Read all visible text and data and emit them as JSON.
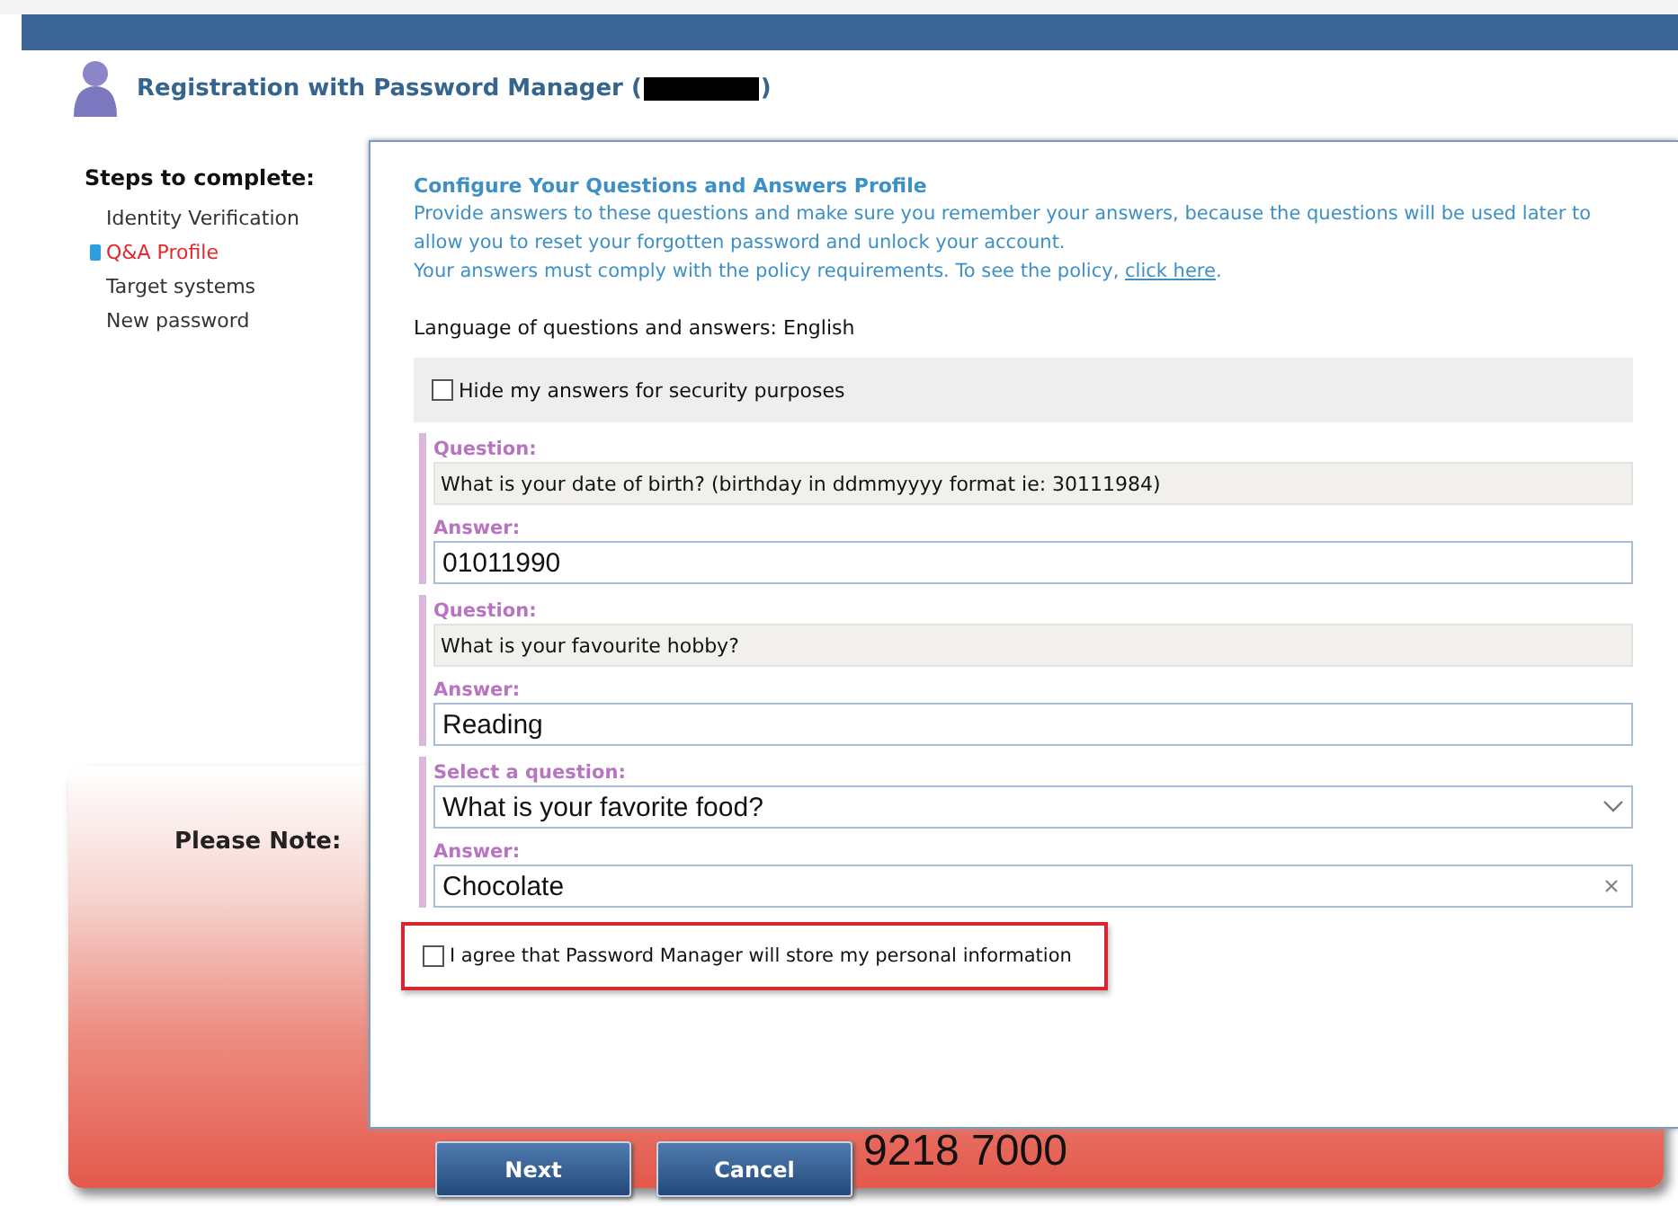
{
  "header": {
    "title": "Registration with Password Manager (",
    "title_end": ")"
  },
  "steps": {
    "heading": "Steps to complete:",
    "items": [
      {
        "label": "Identity Verification",
        "selected": false
      },
      {
        "label": "Q&A Profile",
        "selected": true
      },
      {
        "label": "Target systems",
        "selected": false
      },
      {
        "label": "New password",
        "selected": false
      }
    ]
  },
  "note": {
    "label": "Please Note:",
    "phone": "9218 7000"
  },
  "dialog": {
    "heading": "Configure Your Questions and Answers Profile",
    "intro": "Provide answers to these questions and make sure you remember your answers, because the questions will be used later to allow you to reset your forgotten password and unlock your account.",
    "policy_text": "Your answers must comply with the policy requirements. To see the policy, ",
    "policy_link": "click here",
    "policy_end": ".",
    "language": "Language of questions and answers: English",
    "hide_answers": {
      "label": "Hide my answers for security purposes",
      "checked": false
    },
    "questions": [
      {
        "kind": "fixed",
        "question_label": "Question:",
        "question": "What is your date of birth? (birthday in ddmmyyyy format ie: 30111984)",
        "answer_label": "Answer:",
        "answer": "01011990"
      },
      {
        "kind": "fixed",
        "question_label": "Question:",
        "question": "What is your favourite hobby?",
        "answer_label": "Answer:",
        "answer": "Reading"
      },
      {
        "kind": "select",
        "question_label": "Select a question:",
        "question": "What is your favorite food?",
        "answer_label": "Answer:",
        "answer": "Chocolate",
        "clearable": true
      }
    ],
    "agree": {
      "label": "I agree that Password Manager will store my personal information",
      "checked": false,
      "highlighted": true
    }
  },
  "buttons": [
    {
      "label": "Next"
    },
    {
      "label": "Cancel"
    }
  ]
}
